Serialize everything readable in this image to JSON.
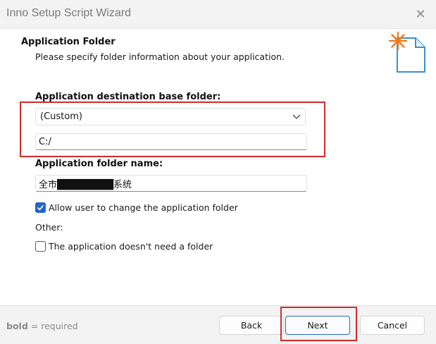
{
  "window": {
    "title": "Inno Setup Script Wizard"
  },
  "header": {
    "title": "Application Folder",
    "subtitle": "Please specify folder information about your application."
  },
  "form": {
    "base_folder_label": "Application destination base folder:",
    "base_folder_selected": "(Custom)",
    "custom_path_value": "C:/",
    "folder_name_label": "Application folder name:",
    "folder_name_value": "全市████████系统",
    "allow_change_label": "Allow user to change the application folder",
    "allow_change_checked": true,
    "other_label": "Other:",
    "no_folder_label": "The application doesn't need a folder",
    "no_folder_checked": false
  },
  "footer": {
    "note_bold": "bold",
    "note_rest": " = required",
    "back_label": "Back",
    "next_label": "Next",
    "cancel_label": "Cancel"
  },
  "colors": {
    "accent": "#2664c4",
    "highlight": "#d22b2b"
  },
  "icons": {
    "close": "close-icon",
    "wizard": "wizard-document-icon",
    "dropdown": "chevron-down-icon",
    "check": "checkmark-icon"
  }
}
